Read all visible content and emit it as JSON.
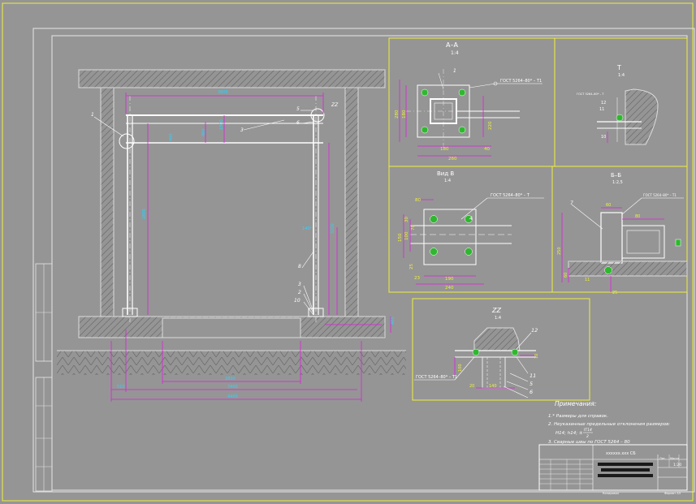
{
  "drawing": {
    "sections": {
      "aa": {
        "title": "А–А",
        "scale": "1:4"
      },
      "t": {
        "title": "Т",
        "scale": "1:4"
      },
      "vidb": {
        "title": "Вид В",
        "scale": "1:4"
      },
      "bb": {
        "title": "Б–Б",
        "scale": "1:2,5"
      },
      "zz": {
        "title": "ZZ",
        "scale": "1:4"
      }
    },
    "callouts": {
      "zz": "ZZ",
      "n1": "1",
      "n2": "2",
      "n3": "3",
      "n4": "4",
      "n5": "5",
      "n6": "6",
      "n7": "7",
      "n8": "8",
      "n10": "10",
      "n11": "11",
      "n12": "12"
    },
    "weld_note": "ГОСТ 5264–80* – Т1",
    "weld_note_short": "ГОСТ 5264–80* – Т",
    "main_dims": {
      "top_span": "3800",
      "beam_h": "1500",
      "post_h": "2800",
      "post_h_right": "3200",
      "col_offset": "400",
      "h1": "460",
      "pit_inner": "2800",
      "pit_mid": "3400",
      "pit_outer": "4400",
      "left_off": "510",
      "right_small": "140*",
      "floor_h": "400"
    },
    "aa_dims": {
      "d1": "280",
      "d2": "180",
      "d3": "180",
      "d4": "40",
      "d5": "260",
      "d6": "220"
    },
    "vidb_dims": {
      "d1": "80",
      "d2": "150",
      "d3": "100",
      "d4": "30",
      "d5": "70",
      "d6": "25",
      "d7": "23",
      "d8": "190",
      "d9": "240"
    },
    "bb_dims": {
      "d1": "60",
      "d2": "80",
      "d3": "250",
      "d4": "60",
      "d5": "11",
      "d6": "25"
    },
    "zz_dims": {
      "d1": "100",
      "d2": "140",
      "d3": "20",
      "d4": "10"
    },
    "notes": {
      "title": "Примечания:",
      "n1": "1.* Размеры для справок.",
      "n2": "2. Неуказанные предельные отклонения размеров:",
      "n2b": "H14; h14; ±",
      "n2c": "IT14",
      "n2d": "2",
      "n3": "3. Сварные швы по ГОСТ 5264 – 80"
    },
    "title_block": {
      "code": "xxxxxx.xxx СБ",
      "sheet_label": "Лит.",
      "mass": "Масса",
      "scale": "1:20",
      "copied": "Копировал",
      "format": "Формат А3"
    }
  }
}
